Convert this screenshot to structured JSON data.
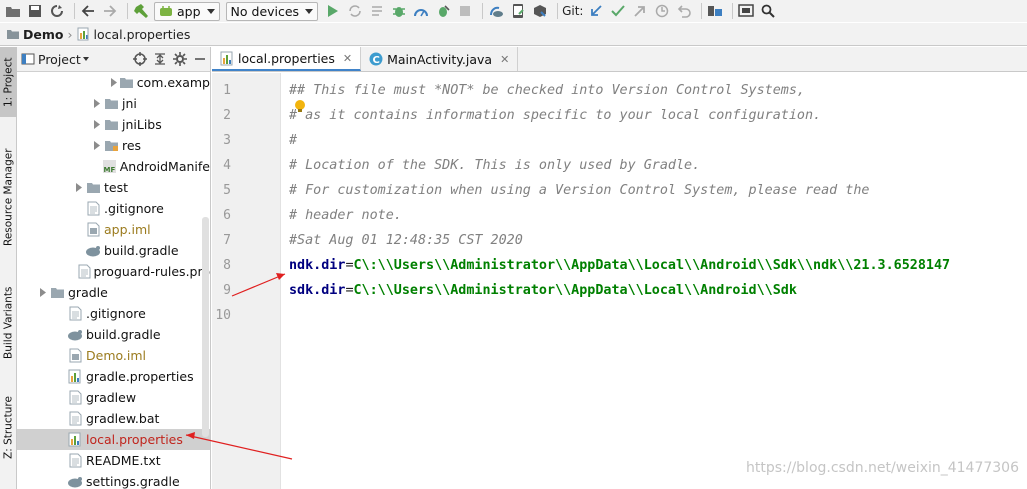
{
  "toolbar": {
    "run_config": "app",
    "device": "No devices",
    "git_label": "Git:"
  },
  "breadcrumb": {
    "project": "Demo",
    "file": "local.properties"
  },
  "left_strip": {
    "project_tab": "1: Project",
    "resource_tab": "Resource Manager",
    "variants_tab": "Build Variants",
    "structure_tab": "Z: Structure"
  },
  "project_panel": {
    "title": "Project",
    "items": [
      {
        "label": "com.examp",
        "indent": 5,
        "arrow": true,
        "icon": "folder"
      },
      {
        "label": "jni",
        "indent": 4,
        "arrow": true,
        "icon": "folder"
      },
      {
        "label": "jniLibs",
        "indent": 4,
        "arrow": true,
        "icon": "folder"
      },
      {
        "label": "res",
        "indent": 4,
        "arrow": true,
        "icon": "res-folder"
      },
      {
        "label": "AndroidManife",
        "indent": 4,
        "arrow": false,
        "icon": "manifest"
      },
      {
        "label": "test",
        "indent": 3,
        "arrow": true,
        "icon": "folder"
      },
      {
        "label": ".gitignore",
        "indent": 3,
        "arrow": false,
        "icon": "text"
      },
      {
        "label": "app.iml",
        "indent": 3,
        "arrow": false,
        "icon": "iml",
        "style": "iml"
      },
      {
        "label": "build.gradle",
        "indent": 3,
        "arrow": false,
        "icon": "gradle"
      },
      {
        "label": "proguard-rules.pro",
        "indent": 3,
        "arrow": false,
        "icon": "text"
      },
      {
        "label": "gradle",
        "indent": 1,
        "arrow": true,
        "icon": "folder"
      },
      {
        "label": ".gitignore",
        "indent": 2,
        "arrow": false,
        "icon": "text"
      },
      {
        "label": "build.gradle",
        "indent": 2,
        "arrow": false,
        "icon": "gradle"
      },
      {
        "label": "Demo.iml",
        "indent": 2,
        "arrow": false,
        "icon": "iml",
        "style": "iml"
      },
      {
        "label": "gradle.properties",
        "indent": 2,
        "arrow": false,
        "icon": "props"
      },
      {
        "label": "gradlew",
        "indent": 2,
        "arrow": false,
        "icon": "text"
      },
      {
        "label": "gradlew.bat",
        "indent": 2,
        "arrow": false,
        "icon": "text"
      },
      {
        "label": "local.properties",
        "indent": 2,
        "arrow": false,
        "icon": "props",
        "style": "red",
        "selected": true
      },
      {
        "label": "README.txt",
        "indent": 2,
        "arrow": false,
        "icon": "text"
      },
      {
        "label": "settings.gradle",
        "indent": 2,
        "arrow": false,
        "icon": "gradle"
      }
    ]
  },
  "editor": {
    "tabs": [
      {
        "label": "local.properties",
        "active": true,
        "icon": "props"
      },
      {
        "label": "MainActivity.java",
        "active": false,
        "icon": "class"
      }
    ],
    "lines": [
      {
        "n": "1",
        "comment": "## This file must *NOT* be checked into Version Control Systems,"
      },
      {
        "n": "2",
        "comment": "# as it contains information specific to your local configuration."
      },
      {
        "n": "3",
        "comment": "#"
      },
      {
        "n": "4",
        "comment": "# Location of the SDK. This is only used by Gradle."
      },
      {
        "n": "5",
        "comment": "# For customization when using a Version Control System, please read the"
      },
      {
        "n": "6",
        "comment": "# header note."
      },
      {
        "n": "7",
        "comment": "#Sat Aug 01 12:48:35 CST 2020"
      },
      {
        "n": "8",
        "key": "ndk.dir",
        "eq": "=",
        "value": "C\\:\\\\Users\\\\Administrator\\\\AppData\\\\Local\\\\Android\\\\Sdk\\\\ndk\\\\21.3.6528147"
      },
      {
        "n": "9",
        "key": "sdk.dir",
        "eq": "=",
        "value": "C\\:\\\\Users\\\\Administrator\\\\AppData\\\\Local\\\\Android\\\\Sdk"
      },
      {
        "n": "10",
        "comment": ""
      }
    ]
  },
  "watermark": "https://blog.csdn.net/weixin_41477306",
  "colors": {
    "annotation_arrow": "#e02020",
    "selection": "#d0d0d0",
    "comment": "#808080",
    "key": "#000080",
    "value": "#008000"
  }
}
